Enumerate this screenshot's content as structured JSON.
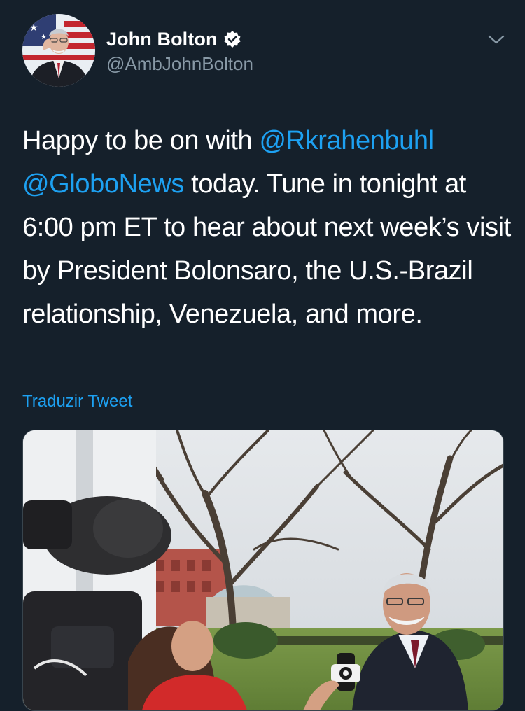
{
  "author": {
    "display_name": "John Bolton",
    "handle": "@AmbJohnBolton",
    "verified": true
  },
  "tweet": {
    "parts": [
      {
        "text": "Happy to be on with "
      },
      {
        "text": "@Rkrahenbuhl",
        "mention": true
      },
      {
        "text": " "
      },
      {
        "text": "@GloboNews",
        "mention": true
      },
      {
        "text": " today. Tune in tonight at 6:00 pm ET to hear about next week’s visit by President Bolonsaro, the U.S.-Brazil relationship, Venezuela, and more."
      }
    ]
  },
  "translate_label": "Traduzir Tweet",
  "icons": {
    "verified": "verified-badge-icon",
    "menu": "chevron-down-icon"
  },
  "colors": {
    "background": "#15202b",
    "accent": "#1da1f2",
    "secondary_text": "#8899a6"
  }
}
